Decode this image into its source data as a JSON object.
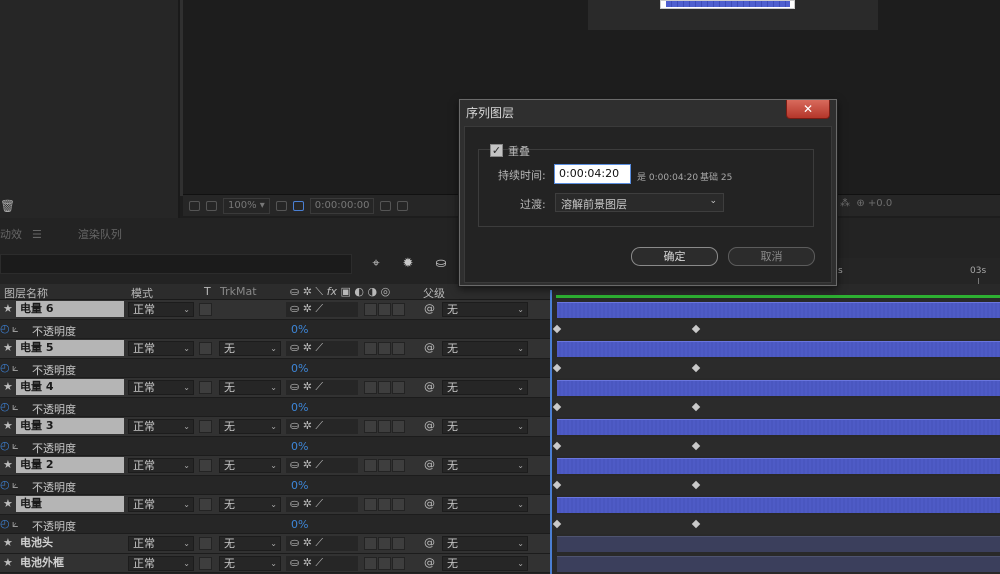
{
  "preview": {
    "resolution": "100%",
    "timecode": "0:00:00:00",
    "offset": "+0.0"
  },
  "tabs": [
    "动效",
    "渲染队列"
  ],
  "timeline_header": {
    "name": "图层名称",
    "mode": "模式",
    "t": "T",
    "trkmat": "TrkMat",
    "fx": "fx",
    "parent": "父级"
  },
  "ruler": {
    "mark1": "s",
    "mark2": "03s"
  },
  "layers": [
    {
      "name": "电量 6",
      "mode": "正常",
      "trkmat": "",
      "parent": "无",
      "prop": "不透明度",
      "pct": "0%",
      "highlight": true
    },
    {
      "name": "电量 5",
      "mode": "正常",
      "trkmat": "无",
      "parent": "无",
      "prop": "不透明度",
      "pct": "0%",
      "highlight": true
    },
    {
      "name": "电量 4",
      "mode": "正常",
      "trkmat": "无",
      "parent": "无",
      "prop": "不透明度",
      "pct": "0%",
      "highlight": true
    },
    {
      "name": "电量 3",
      "mode": "正常",
      "trkmat": "无",
      "parent": "无",
      "prop": "不透明度",
      "pct": "0%",
      "highlight": true
    },
    {
      "name": "电量 2",
      "mode": "正常",
      "trkmat": "无",
      "parent": "无",
      "prop": "不透明度",
      "pct": "0%",
      "highlight": true
    },
    {
      "name": "电量",
      "mode": "正常",
      "trkmat": "无",
      "parent": "无",
      "prop": "不透明度",
      "pct": "0%",
      "highlight": true
    },
    {
      "name": "电池头",
      "mode": "正常",
      "trkmat": "无",
      "parent": "无",
      "highlight": false
    },
    {
      "name": "电池外框",
      "mode": "正常",
      "trkmat": "无",
      "parent": "无",
      "highlight": false
    }
  ],
  "dialog": {
    "title": "序列图层",
    "close": "✕",
    "overlap_label": "重叠",
    "duration_label": "持续时间:",
    "duration_value": "0:00:04:20",
    "duration_note": "是 0:00:04:20",
    "base_note": "基础 25",
    "transition_label": "过渡:",
    "transition_value": "溶解前景图层",
    "ok": "确定",
    "cancel": "取消"
  },
  "colors": {
    "layer_bar": "#4e5bc6",
    "work_area": "#2db032",
    "playhead": "#4b7fd3",
    "close": "#c8463a"
  }
}
